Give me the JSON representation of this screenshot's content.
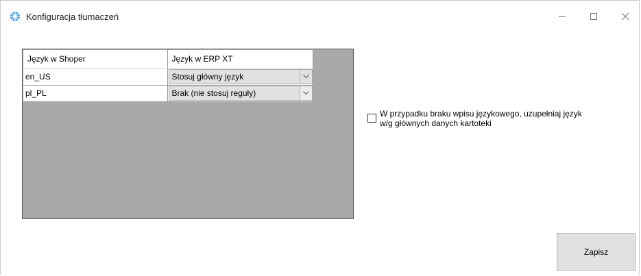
{
  "window": {
    "title": "Konfiguracja tłumaczeń",
    "icon": "gear-snowflake-icon",
    "controls": [
      "minimize-icon",
      "maximize-icon",
      "close-icon"
    ]
  },
  "grid": {
    "columns": [
      "Język w Shoper",
      "Język w ERP XT"
    ],
    "rows": [
      {
        "language": "en_US",
        "mapping": "Stosuj główny język"
      },
      {
        "language": "pl_PL",
        "mapping": "Brak (nie stosuj reguły)"
      }
    ]
  },
  "option": {
    "label": "W przypadku braku wpisu językowego, uzupełniaj język w/g głównych danych kartoteki",
    "checked": false
  },
  "buttons": {
    "save_label": "Zapisz"
  },
  "colors": {
    "grid_background": "#a9a9a9",
    "button_face": "#e1e1e1",
    "icon_accent": "#4aa3df"
  }
}
